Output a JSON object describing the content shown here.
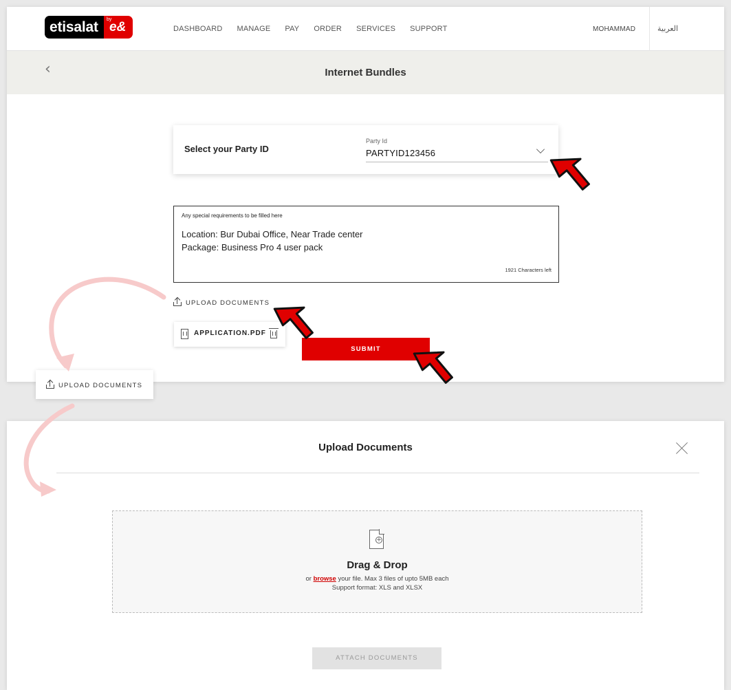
{
  "brand": {
    "logo_text": "etisalat",
    "logo_by": "by",
    "logo_mark": "e&"
  },
  "nav": {
    "items": [
      "DASHBOARD",
      "MANAGE",
      "PAY",
      "ORDER",
      "SERVICES",
      "SUPPORT"
    ],
    "user": "MOHAMMAD",
    "language": "العربية"
  },
  "page": {
    "title": "Internet Bundles",
    "back_icon": "chevron-left-icon"
  },
  "party": {
    "label": "Select your Party ID",
    "field_label": "Party Id",
    "value": "PARTYID123456"
  },
  "requirements": {
    "label": "Any special requirements to be filled here",
    "line1": "Location: Bur Dubai Office, Near Trade center",
    "line2": "Package: Business Pro 4 user pack",
    "chars_left": "1921 Characters left"
  },
  "upload": {
    "link_label": "UPLOAD DOCUMENTS"
  },
  "attachment": {
    "filename": "APPLICATION.PDF"
  },
  "submit_label": "SUBMIT",
  "float_chip_label": "UPLOAD DOCUMENTS",
  "modal": {
    "title": "Upload Documents",
    "dz_title": "Drag & Drop",
    "dz_prefix": "or ",
    "dz_link": "browse",
    "dz_suffix": " your file. Max 3 files of upto 5MB each",
    "dz_formats": "Support format: XLS and XLSX",
    "attach_label": "ATTACH DOCUMENTS"
  },
  "colors": {
    "accent": "#e00000",
    "title_bar": "#efefeb",
    "cursor_red": "#e00000"
  }
}
